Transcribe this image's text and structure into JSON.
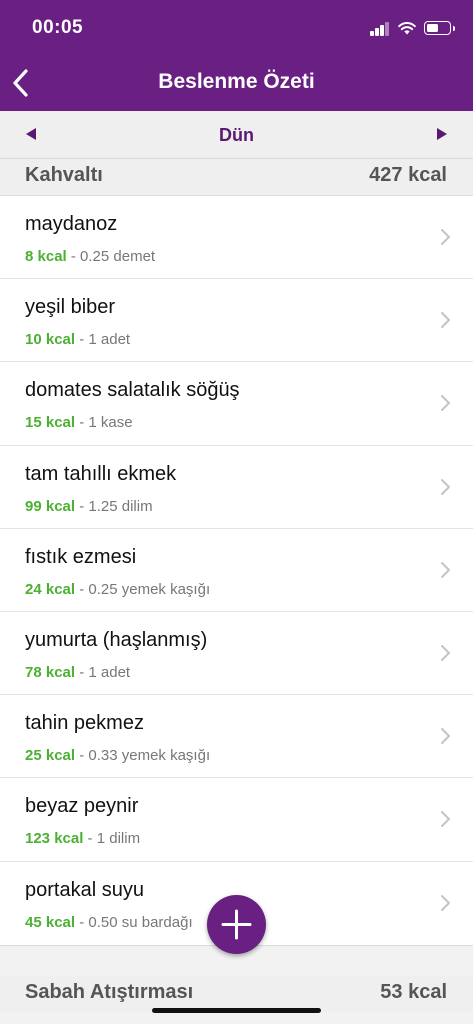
{
  "status_bar": {
    "time": "00:05",
    "icons": [
      "cellular-signal-icon",
      "wifi-icon",
      "battery-icon"
    ]
  },
  "header": {
    "title": "Beslenme Özeti",
    "back_icon": "chevron-left-icon",
    "bg_color": "#6a1f83"
  },
  "date_nav": {
    "label": "Dün",
    "prev_icon": "triangle-left-icon",
    "next_icon": "triangle-right-icon"
  },
  "sections": [
    {
      "name": "Kahvaltı",
      "total": "427 kcal",
      "items": [
        {
          "name": "maydanoz",
          "kcal": "8 kcal",
          "portion": " - 0.25 demet"
        },
        {
          "name": "yeşil biber",
          "kcal": "10 kcal",
          "portion": " - 1 adet"
        },
        {
          "name": "domates salatalık söğüş",
          "kcal": "15 kcal",
          "portion": " - 1 kase"
        },
        {
          "name": "tam tahıllı ekmek",
          "kcal": "99 kcal",
          "portion": " - 1.25 dilim"
        },
        {
          "name": "fıstık ezmesi",
          "kcal": "24 kcal",
          "portion": " - 0.25 yemek kaşığı"
        },
        {
          "name": "yumurta (haşlanmış)",
          "kcal": "78 kcal",
          "portion": " - 1 adet"
        },
        {
          "name": "tahin pekmez",
          "kcal": "25 kcal",
          "portion": " - 0.33 yemek kaşığı"
        },
        {
          "name": "beyaz peynir",
          "kcal": "123 kcal",
          "portion": " - 1 dilim"
        },
        {
          "name": "portakal suyu",
          "kcal": "45 kcal",
          "portion": " - 0.50 su bardağı"
        }
      ]
    },
    {
      "name": "Sabah Atıştırması",
      "total": "53 kcal",
      "items": []
    }
  ],
  "fab": {
    "icon": "plus-icon"
  },
  "colors": {
    "accent": "#6a1f83",
    "kcal_green": "#4cb033"
  }
}
